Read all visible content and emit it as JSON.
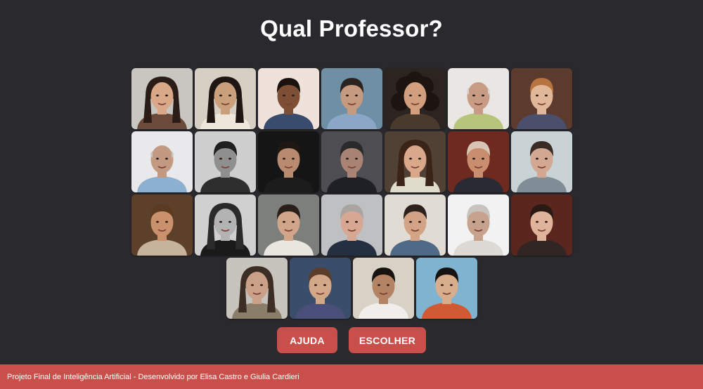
{
  "title": "Qual Professor?",
  "buttons": {
    "help": "AJUDA",
    "choose": "ESCOLHER"
  },
  "footer": {
    "text": "Projeto Final de Inteligência Artificial - Desenvolvido por Elisa Castro e Giulia Cardieri"
  },
  "colors": {
    "background": "#2a292d",
    "accent": "#c9504a"
  },
  "rows": [
    [
      {
        "bg": "#c8c6c1",
        "skin": "#d8a888",
        "hair": "#2a1d17",
        "shirt": "#6b4a3a",
        "hairstyle": "long"
      },
      {
        "bg": "#d7cfc3",
        "skin": "#caa07c",
        "hair": "#1e1612",
        "shirt": "#efe6da",
        "hairstyle": "long"
      },
      {
        "bg": "#efe2da",
        "skin": "#7d4f34",
        "hair": "#1a120e",
        "shirt": "#3a4c6e",
        "hairstyle": "short"
      },
      {
        "bg": "#6e8fa4",
        "skin": "#c59a7f",
        "hair": "#2b231f",
        "shirt": "#8aa7c8",
        "hairstyle": "short"
      },
      {
        "bg": "#2b2420",
        "skin": "#d19e7e",
        "hair": "#1b1410",
        "shirt": "#4a3a2e",
        "hairstyle": "curly"
      },
      {
        "bg": "#e9e6e3",
        "skin": "#c89c84",
        "hair": "#d8d2cd",
        "shirt": "#b6c57a",
        "hairstyle": "bald"
      },
      {
        "bg": "#5c3a2e",
        "skin": "#e1b79a",
        "hair": "#b8743e",
        "shirt": "#4a4f6b",
        "hairstyle": "short"
      }
    ],
    [
      {
        "bg": "#e9e8ea",
        "skin": "#c29a82",
        "hair": "#cdc7c2",
        "shirt": "#8cb0cf",
        "hairstyle": "bald"
      },
      {
        "bg": "#cfcfcf",
        "skin": "#8f8f8f",
        "hair": "#1f1f1f",
        "shirt": "#2e2e2e",
        "hairstyle": "short"
      },
      {
        "bg": "#151515",
        "skin": "#b88a70",
        "hair": "#201612",
        "shirt": "#1c1c1c",
        "hairstyle": "short"
      },
      {
        "bg": "#4d4d52",
        "skin": "#a98474",
        "hair": "#2a2a2a",
        "shirt": "#1f1f26",
        "hairstyle": "short"
      },
      {
        "bg": "#514034",
        "skin": "#d9a78a",
        "hair": "#3a2418",
        "shirt": "#e0dccb",
        "hairstyle": "long"
      },
      {
        "bg": "#6e2a1e",
        "skin": "#c88e6e",
        "hair": "#d7c6b6",
        "shirt": "#2a2a35",
        "hairstyle": "short"
      },
      {
        "bg": "#c9d3d6",
        "skin": "#d2a892",
        "hair": "#3a2b24",
        "shirt": "#7f8e96",
        "hairstyle": "short"
      }
    ],
    [
      {
        "bg": "#5d4029",
        "skin": "#c9926c",
        "hair": "#5a3a20",
        "shirt": "#c6b39b",
        "hairstyle": "short"
      },
      {
        "bg": "#d0d0d0",
        "skin": "#b3b3b3",
        "hair": "#2a2a2a",
        "shirt": "#1a1a1a",
        "hairstyle": "long"
      },
      {
        "bg": "#7d7f7d",
        "skin": "#d1a58a",
        "hair": "#2a1e18",
        "shirt": "#e8e6de",
        "hairstyle": "short"
      },
      {
        "bg": "#bfc0c2",
        "skin": "#d6a894",
        "hair": "#a9a4a1",
        "shirt": "#24303f",
        "hairstyle": "short"
      },
      {
        "bg": "#e0dcd4",
        "skin": "#d3a386",
        "hair": "#2c211b",
        "shirt": "#4f6a87",
        "hairstyle": "short"
      },
      {
        "bg": "#f2f2f2",
        "skin": "#c7a28d",
        "hair": "#c8c3be",
        "shirt": "#ddd9d4",
        "hairstyle": "short"
      },
      {
        "bg": "#5a261d",
        "skin": "#e0b49b",
        "hair": "#2a1a14",
        "shirt": "#312624",
        "hairstyle": "short"
      }
    ],
    [
      {
        "bg": "#c7c3bd",
        "skin": "#caa088",
        "hair": "#3c2e25",
        "shirt": "#8a7e6a",
        "hairstyle": "long"
      },
      {
        "bg": "#3a4d6b",
        "skin": "#d2a889",
        "hair": "#5a3e2a",
        "shirt": "#4a4f7a",
        "hairstyle": "short"
      },
      {
        "bg": "#d8d2c6",
        "skin": "#b48363",
        "hair": "#171311",
        "shirt": "#f0eeea",
        "hairstyle": "short"
      },
      {
        "bg": "#7fb3cf",
        "skin": "#d8ad8c",
        "hair": "#161312",
        "shirt": "#d05a34",
        "hairstyle": "short"
      }
    ]
  ]
}
